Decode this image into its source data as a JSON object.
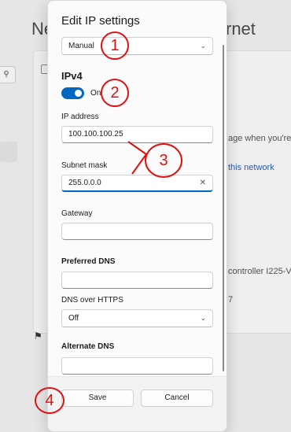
{
  "background": {
    "title_left": "Ne",
    "title_right": "rnet",
    "text_lines": [
      "age when you're",
      "this network",
      "controller I225-V",
      "7"
    ],
    "search_icon": "search-icon"
  },
  "dialog": {
    "title": "Edit IP settings",
    "mode_select": {
      "value": "Manual"
    },
    "ipv4": {
      "heading": "IPv4",
      "toggle_label": "On",
      "toggle_on": true
    },
    "fields": {
      "ip_address": {
        "label": "IP address",
        "value": "100.100.100.25"
      },
      "subnet_mask": {
        "label": "Subnet mask",
        "value": "255.0.0.0"
      },
      "gateway": {
        "label": "Gateway",
        "value": ""
      },
      "preferred_dns": {
        "label": "Preferred DNS",
        "value": ""
      },
      "dns_over_https": {
        "label": "DNS over HTTPS",
        "value": "Off"
      },
      "alternate_dns": {
        "label": "Alternate DNS",
        "value": ""
      }
    },
    "buttons": {
      "save": "Save",
      "cancel": "Cancel"
    }
  },
  "annotations": [
    "1",
    "2",
    "3",
    "4"
  ],
  "colors": {
    "accent": "#0067c0",
    "annotation": "#e01010"
  }
}
